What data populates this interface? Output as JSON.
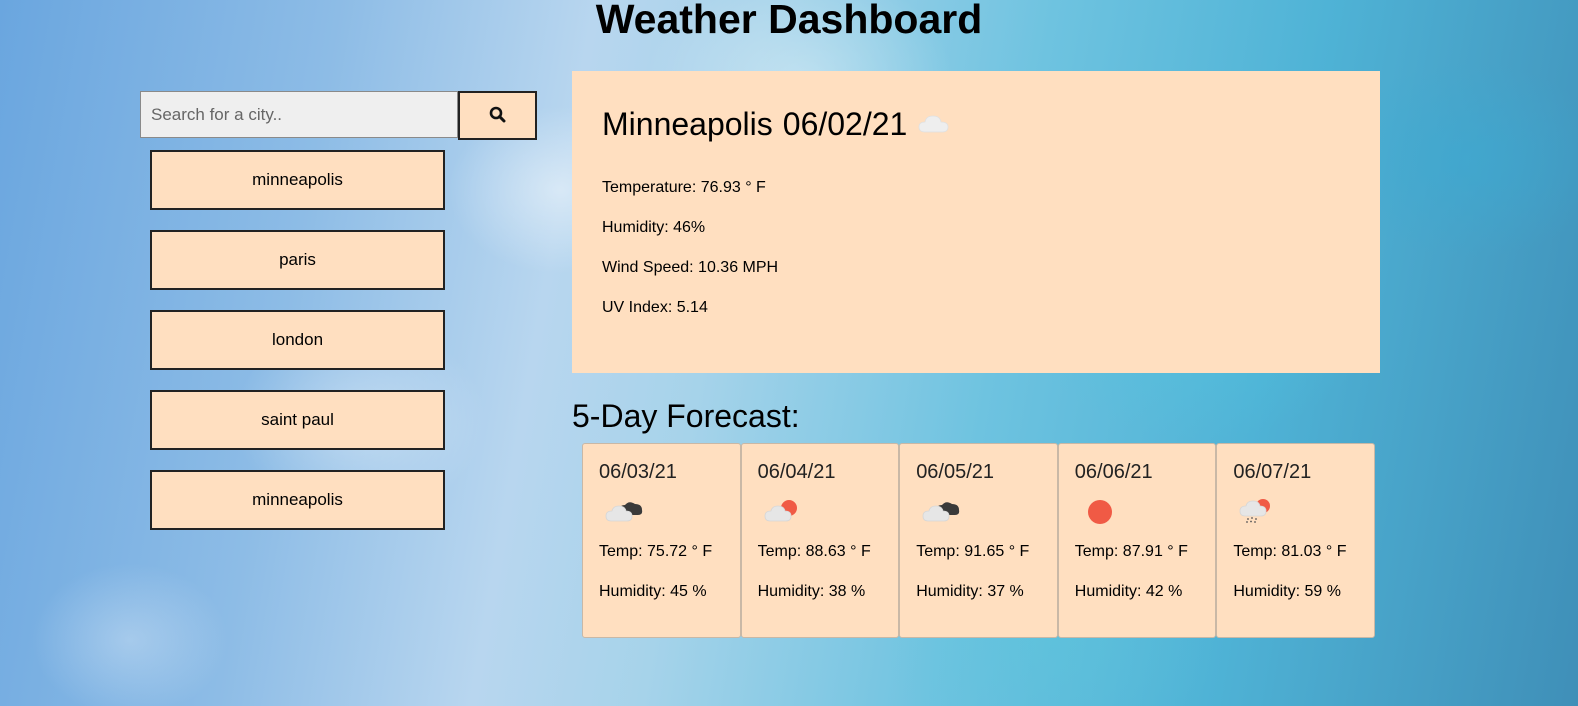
{
  "header": {
    "title": "Weather Dashboard"
  },
  "search": {
    "placeholder": "Search for a city..",
    "value": "",
    "button_icon": "search-icon"
  },
  "history": [
    {
      "label": "minneapolis"
    },
    {
      "label": "paris"
    },
    {
      "label": "london"
    },
    {
      "label": "saint paul"
    },
    {
      "label": "minneapolis"
    }
  ],
  "current": {
    "city": "Minneapolis",
    "date": "06/02/21",
    "icon": "cloud-icon",
    "temperature": "Temperature: 76.93 ° F",
    "humidity": "Humidity: 46%",
    "wind_speed": "Wind Speed: 10.36 MPH",
    "uv_index": "UV Index: 5.14"
  },
  "forecast": {
    "title": "5-Day Forecast:",
    "days": [
      {
        "date": "06/03/21",
        "icon": "broken-clouds-icon",
        "temp": "Temp: 75.72 ° F",
        "humidity": "Humidity: 45 %"
      },
      {
        "date": "06/04/21",
        "icon": "few-clouds-icon",
        "temp": "Temp: 88.63 ° F",
        "humidity": "Humidity: 38 %"
      },
      {
        "date": "06/05/21",
        "icon": "broken-clouds-icon",
        "temp": "Temp: 91.65 ° F",
        "humidity": "Humidity: 37 %"
      },
      {
        "date": "06/06/21",
        "icon": "clear-sky-icon",
        "temp": "Temp: 87.91 ° F",
        "humidity": "Humidity: 42 %"
      },
      {
        "date": "06/07/21",
        "icon": "rain-icon",
        "temp": "Temp: 81.03 ° F",
        "humidity": "Humidity: 59 %"
      }
    ]
  },
  "colors": {
    "card": "#ffdfc0",
    "sun": "#f05a45",
    "cloud_light": "#e6e6e6",
    "cloud_dark": "#3a3a3a"
  }
}
